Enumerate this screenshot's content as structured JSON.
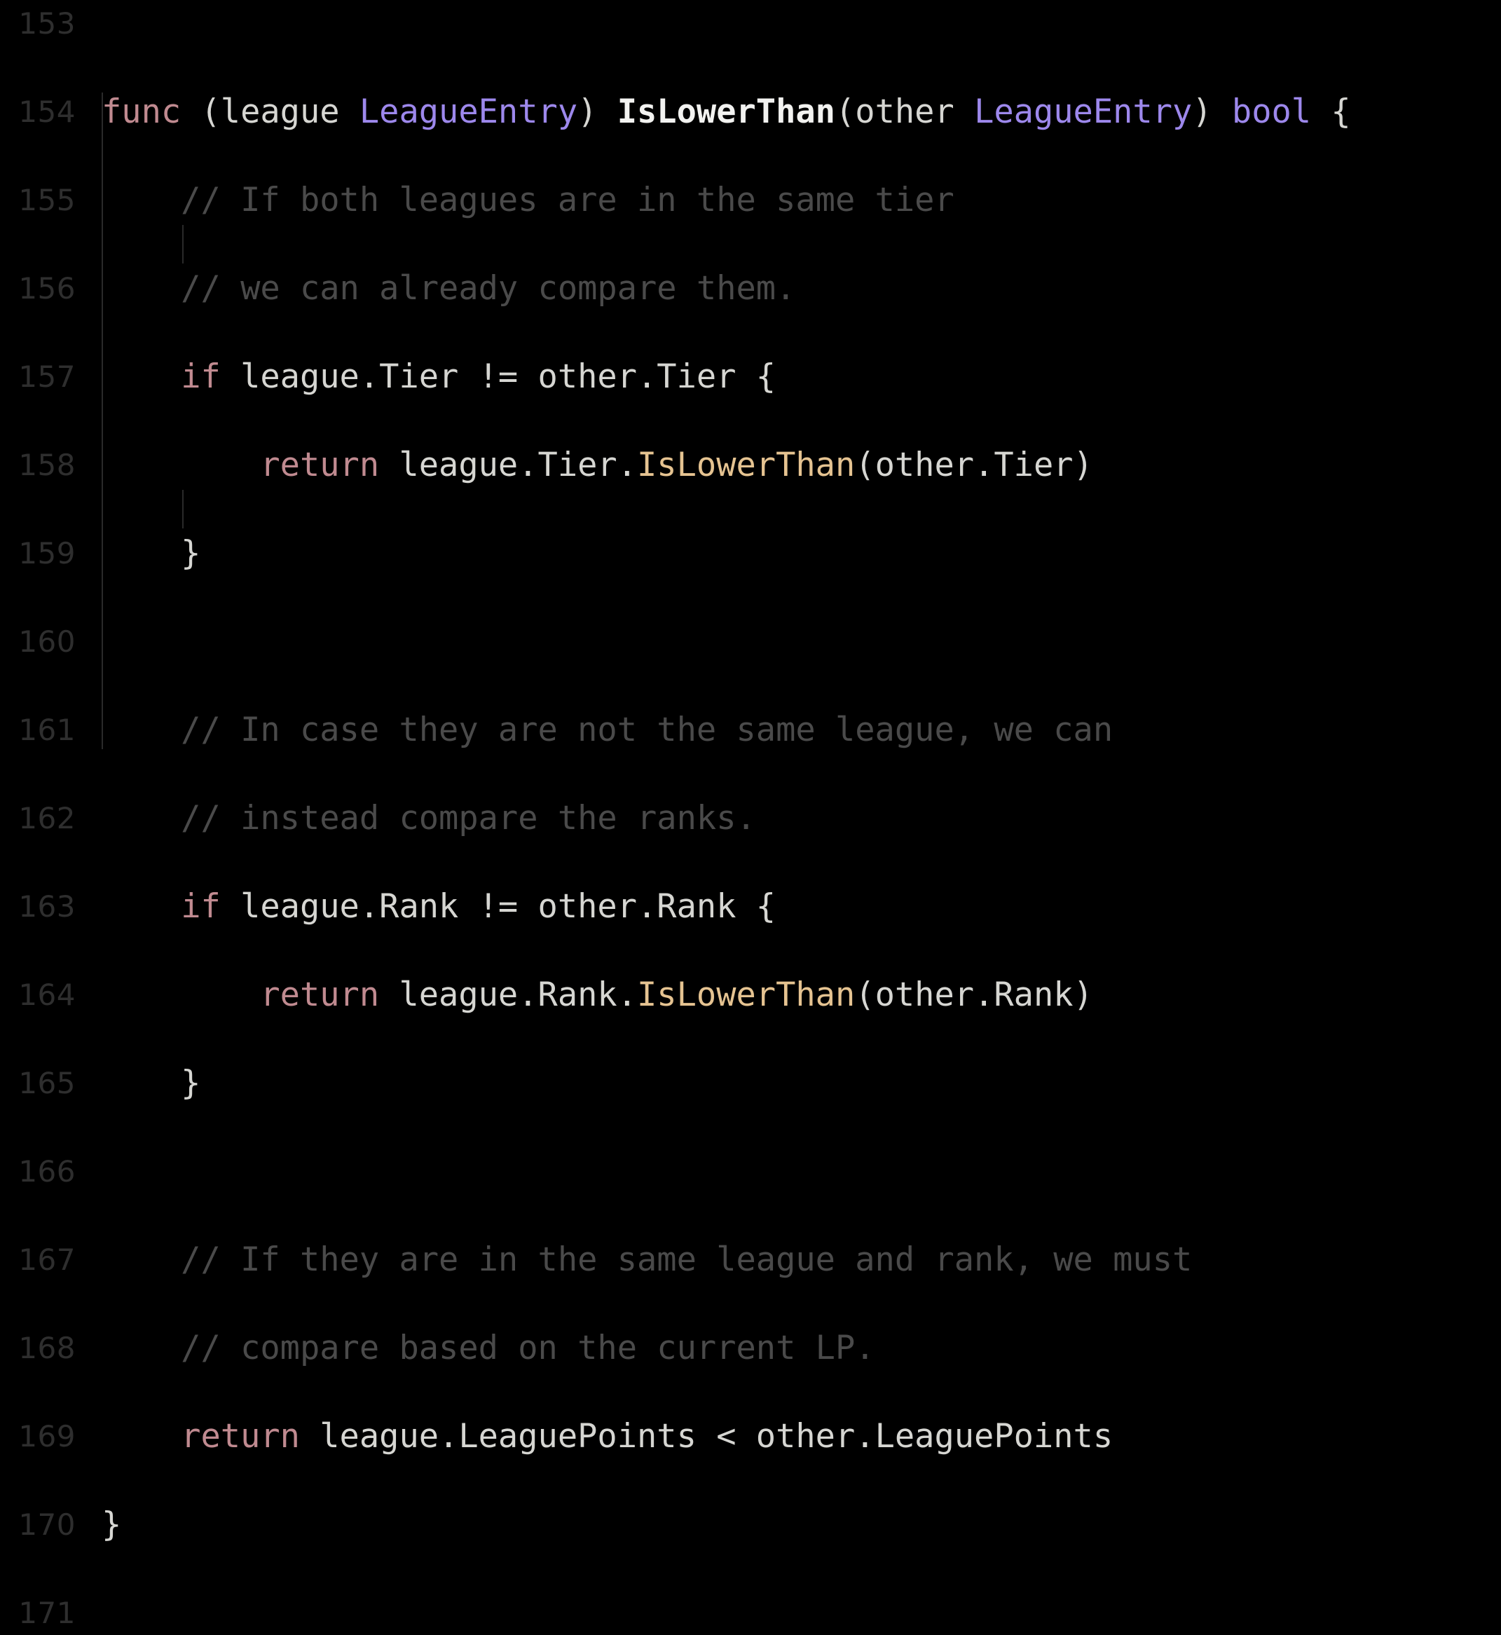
{
  "editor": {
    "language": "Go",
    "background_color": "#000000",
    "gutter_color": "#2e2e2e",
    "indent_guide_color": "#2a2a2a",
    "first_line_number": 153,
    "last_line_number": 171,
    "colors": {
      "default_text": "#d6d6d2",
      "keyword": "#c08a90",
      "type": "#9d88ec",
      "function_definition": "#f2f2f0",
      "method_call": "#e5c391",
      "comment": "#4a4a4a"
    }
  },
  "lines": [
    {
      "number": "153",
      "tokens": []
    },
    {
      "number": "154",
      "tokens": [
        {
          "t": "func",
          "c": "keyword"
        },
        {
          "t": " (league ",
          "c": "default"
        },
        {
          "t": "LeagueEntry",
          "c": "type"
        },
        {
          "t": ") ",
          "c": "default"
        },
        {
          "t": "IsLowerThan",
          "c": "funcdef"
        },
        {
          "t": "(other ",
          "c": "default"
        },
        {
          "t": "LeagueEntry",
          "c": "type"
        },
        {
          "t": ") ",
          "c": "default"
        },
        {
          "t": "bool",
          "c": "type"
        },
        {
          "t": " {",
          "c": "default"
        }
      ]
    },
    {
      "number": "155",
      "tokens": [
        {
          "t": "    // If both leagues are in the same tier",
          "c": "comment"
        }
      ]
    },
    {
      "number": "156",
      "tokens": [
        {
          "t": "    // we can already compare them.",
          "c": "comment"
        }
      ]
    },
    {
      "number": "157",
      "tokens": [
        {
          "t": "    ",
          "c": "default"
        },
        {
          "t": "if",
          "c": "keyword"
        },
        {
          "t": " league.Tier != other.Tier {",
          "c": "default"
        }
      ]
    },
    {
      "number": "158",
      "tokens": [
        {
          "t": "        ",
          "c": "default"
        },
        {
          "t": "return",
          "c": "keyword"
        },
        {
          "t": " league.Tier.",
          "c": "default"
        },
        {
          "t": "IsLowerThan",
          "c": "method"
        },
        {
          "t": "(other.Tier)",
          "c": "default"
        }
      ]
    },
    {
      "number": "159",
      "tokens": [
        {
          "t": "    }",
          "c": "default"
        }
      ]
    },
    {
      "number": "160",
      "tokens": []
    },
    {
      "number": "161",
      "tokens": [
        {
          "t": "    // In case they are not the same league, we can",
          "c": "comment"
        }
      ]
    },
    {
      "number": "162",
      "tokens": [
        {
          "t": "    // instead compare the ranks.",
          "c": "comment"
        }
      ]
    },
    {
      "number": "163",
      "tokens": [
        {
          "t": "    ",
          "c": "default"
        },
        {
          "t": "if",
          "c": "keyword"
        },
        {
          "t": " league.Rank != other.Rank {",
          "c": "default"
        }
      ]
    },
    {
      "number": "164",
      "tokens": [
        {
          "t": "        ",
          "c": "default"
        },
        {
          "t": "return",
          "c": "keyword"
        },
        {
          "t": " league.Rank.",
          "c": "default"
        },
        {
          "t": "IsLowerThan",
          "c": "method"
        },
        {
          "t": "(other.Rank)",
          "c": "default"
        }
      ]
    },
    {
      "number": "165",
      "tokens": [
        {
          "t": "    }",
          "c": "default"
        }
      ]
    },
    {
      "number": "166",
      "tokens": []
    },
    {
      "number": "167",
      "tokens": [
        {
          "t": "    // If they are in the same league and rank, we must",
          "c": "comment"
        }
      ]
    },
    {
      "number": "168",
      "tokens": [
        {
          "t": "    // compare based on the current LP.",
          "c": "comment"
        }
      ]
    },
    {
      "number": "169",
      "tokens": [
        {
          "t": "    ",
          "c": "default"
        },
        {
          "t": "return",
          "c": "keyword"
        },
        {
          "t": " league.LeaguePoints < other.LeaguePoints",
          "c": "default"
        }
      ]
    },
    {
      "number": "170",
      "tokens": [
        {
          "t": "}",
          "c": "default"
        }
      ]
    },
    {
      "number": "171",
      "tokens": []
    }
  ],
  "indent_guides": [
    {
      "level": 1,
      "start_line": "155",
      "end_line": "169"
    },
    {
      "level": 2,
      "start_line": "158",
      "end_line": "158"
    },
    {
      "level": 2,
      "start_line": "164",
      "end_line": "164"
    }
  ]
}
